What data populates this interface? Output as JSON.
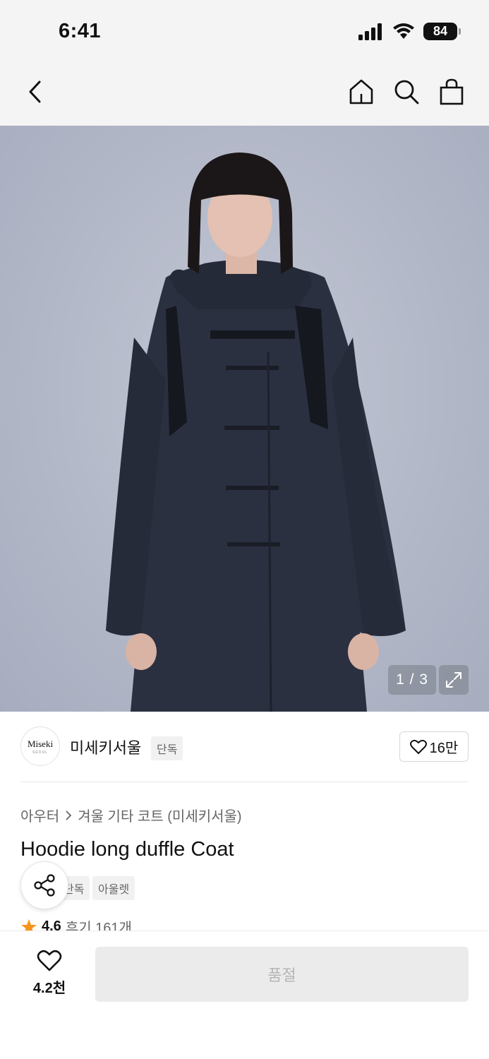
{
  "status_bar": {
    "time": "6:41",
    "battery": "84"
  },
  "nav": {
    "back": "back",
    "home": "home",
    "search": "search",
    "cart": "shopping-bag"
  },
  "gallery": {
    "counter": "1 / 3"
  },
  "brand": {
    "logo_line1": "Miseki",
    "logo_line2": "SEOUL",
    "name": "미세키서울",
    "exclusive_tag": "단독",
    "likes": "16만"
  },
  "product": {
    "breadcrumb": [
      "아우터",
      "겨울 기타 코트 (미세키서울)"
    ],
    "title": "Hoodie long duffle Coat",
    "tags": [
      "단독",
      "아울렛"
    ],
    "rating": "4.6",
    "reviews": "후기 161개"
  },
  "bottom_bar": {
    "wishlist_count": "4.2천",
    "buy_label": "품절"
  },
  "colors": {
    "accent_star": "#f7941d",
    "disabled_button": "#ebebeb"
  }
}
